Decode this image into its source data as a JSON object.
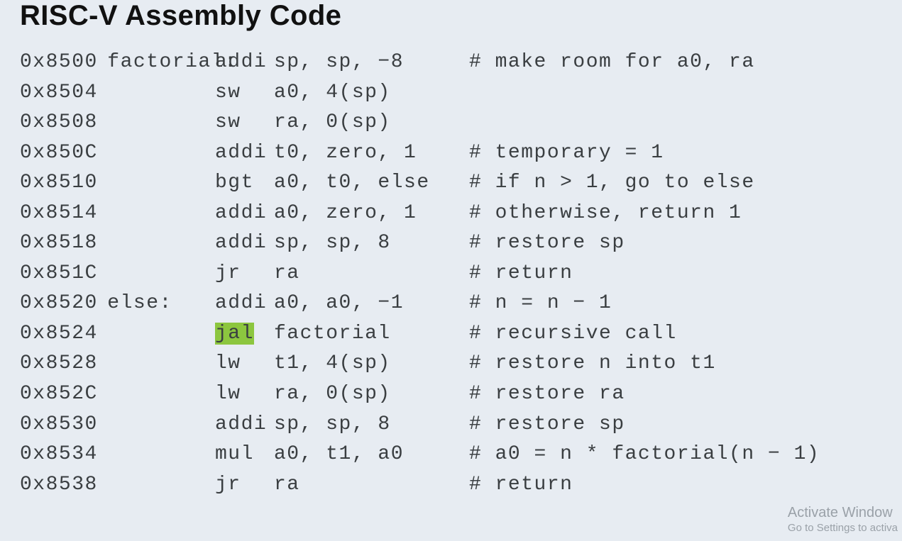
{
  "title": "RISC-V Assembly Code",
  "rows": [
    {
      "addr": "0x8500",
      "label": "factorial:",
      "opcode": "addi",
      "operand": "sp, sp, −8",
      "comment": "# make room for a0, ra",
      "hl": false
    },
    {
      "addr": "0x8504",
      "label": "",
      "opcode": "sw",
      "operand": "a0, 4(sp)",
      "comment": "",
      "hl": false
    },
    {
      "addr": "0x8508",
      "label": "",
      "opcode": "sw",
      "operand": "ra, 0(sp)",
      "comment": "",
      "hl": false
    },
    {
      "addr": "0x850C",
      "label": "",
      "opcode": "addi",
      "operand": "t0, zero, 1",
      "comment": "# temporary = 1",
      "hl": false
    },
    {
      "addr": "0x8510",
      "label": "",
      "opcode": "bgt",
      "operand": "a0, t0, else",
      "comment": "# if n > 1, go to else",
      "hl": false
    },
    {
      "addr": "0x8514",
      "label": "",
      "opcode": "addi",
      "operand": "a0, zero, 1",
      "comment": "# otherwise, return 1",
      "hl": false
    },
    {
      "addr": "0x8518",
      "label": "",
      "opcode": "addi",
      "operand": "sp, sp, 8",
      "comment": "# restore sp",
      "hl": false
    },
    {
      "addr": "0x851C",
      "label": "",
      "opcode": "jr",
      "operand": "ra",
      "comment": "# return",
      "hl": false
    },
    {
      "addr": "0x8520",
      "label": "else:",
      "opcode": "addi",
      "operand": "a0, a0, −1",
      "comment": "# n = n − 1",
      "hl": false
    },
    {
      "addr": "0x8524",
      "label": "",
      "opcode": "jal",
      "operand": "factorial",
      "comment": "# recursive call",
      "hl": true
    },
    {
      "addr": "0x8528",
      "label": "",
      "opcode": "lw",
      "operand": "t1, 4(sp)",
      "comment": "# restore n into t1",
      "hl": false
    },
    {
      "addr": "0x852C",
      "label": "",
      "opcode": "lw",
      "operand": "ra, 0(sp)",
      "comment": "# restore ra",
      "hl": false
    },
    {
      "addr": "0x8530",
      "label": "",
      "opcode": "addi",
      "operand": "sp, sp, 8",
      "comment": "# restore sp",
      "hl": false
    },
    {
      "addr": "0x8534",
      "label": "",
      "opcode": "mul",
      "operand": "a0, t1, a0",
      "comment": "# a0 = n * factorial(n − 1)",
      "hl": false
    },
    {
      "addr": "0x8538",
      "label": "",
      "opcode": "jr",
      "operand": "ra",
      "comment": "# return",
      "hl": false
    }
  ],
  "watermark": {
    "line1": "Activate Window",
    "line2": "Go to Settings to activa"
  }
}
